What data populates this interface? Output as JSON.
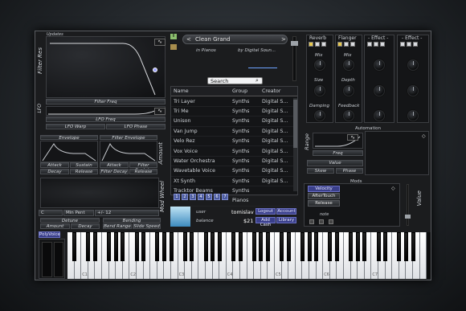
{
  "ui": {
    "updates": "Updates",
    "filter_res": "Filter Res",
    "filter_freq": "Filter Freq",
    "lfo": "LFO",
    "lfo_freq": "LFO Freq",
    "lfo_warp": "LFO Warp",
    "lfo_phase": "LFO Phase",
    "envelope": "Envelope",
    "filter_envelope": "Filter Envelope",
    "attack": "Attack",
    "sustain": "Sustain",
    "decay": "Decay",
    "release": "Release",
    "filter_sustain": "Filter Sustain",
    "filter_decay": "Filter Decay",
    "amount": "Amount",
    "mod_wheel": "Mod Wheel",
    "key": "C",
    "scale": "Min Pent",
    "range": "+/- 12",
    "detune": "Detune",
    "bending": "Bending",
    "bend_range": "Bend Range",
    "slide_speed": "Slide Speed",
    "polyvoice": "PolyVoice"
  },
  "preset": {
    "name": "Clean Grand",
    "category": "in Pianos",
    "author": "by Digital Soun...",
    "prev": "<",
    "next": ">"
  },
  "browser": {
    "search_placeholder": "Search",
    "columns": [
      "Name",
      "Group",
      "Creator"
    ],
    "rows": [
      [
        "Tri Layer",
        "Synths",
        "Digital S..."
      ],
      [
        "Tri Me",
        "Synths",
        "Digital S..."
      ],
      [
        "Unison",
        "Synths",
        "Digital S..."
      ],
      [
        "Van Jump",
        "Synths",
        "Digital S..."
      ],
      [
        "Velo Rez",
        "Synths",
        "Digital S..."
      ],
      [
        "Vox Voice",
        "Synths",
        "Digital S..."
      ],
      [
        "Water Orchestra",
        "Synths",
        "Digital S..."
      ],
      [
        "Wavetable Voice",
        "Synths",
        "Digital S..."
      ],
      [
        "Xt Synth",
        "Synths",
        "Digital S..."
      ],
      [
        "Tracktor Beams",
        "Synths",
        ""
      ],
      [
        "",
        "Pianos",
        ""
      ]
    ],
    "pages": [
      "1",
      "2",
      "3",
      "4",
      "5",
      "6",
      "7"
    ]
  },
  "account": {
    "user_label": "user",
    "user": "tomislav",
    "balance_label": "balance",
    "balance": "$21",
    "logout": "Logout",
    "account": "Account",
    "add_cash": "Add Cash",
    "library": "Library"
  },
  "effects": {
    "reverb": "Reverb",
    "flanger": "Flanger",
    "effect3": "- Effect -",
    "effect4": "- Effect -",
    "mix": "Mix",
    "size": "Size",
    "damping": "Damping",
    "depth": "Depth",
    "feedback": "Feedback"
  },
  "automation": {
    "title": "Automation",
    "range": "Range",
    "freq": "Freq",
    "value": "Value",
    "skew": "Skew",
    "phase": "Phase"
  },
  "mods": {
    "title": "Mods",
    "velocity": "Velocity",
    "aftertouch": "AfterTouch",
    "release": "Release",
    "note": "note",
    "value": "Value"
  },
  "keyboard": {
    "octaves": [
      "C1",
      "C2",
      "C3",
      "C4",
      "C5",
      "C6",
      "C7"
    ]
  }
}
